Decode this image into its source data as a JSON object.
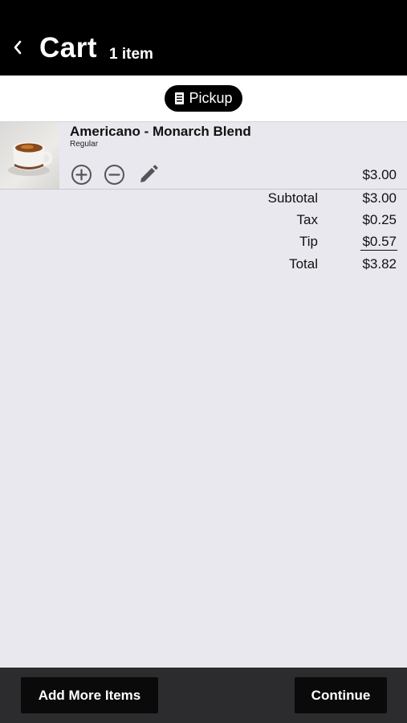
{
  "header": {
    "title": "Cart",
    "count": "1 item",
    "back_icon": "chevron-left-icon"
  },
  "order_mode": {
    "label": "Pickup",
    "icon": "receipt-icon"
  },
  "items": [
    {
      "name": "Americano - Monarch Blend",
      "variant": "Regular",
      "price": "$3.00",
      "controls": [
        "plus-circle-icon",
        "minus-circle-icon",
        "pencil-icon"
      ]
    }
  ],
  "summary": [
    {
      "label": "Subtotal",
      "value": "$3.00"
    },
    {
      "label": "Tax",
      "value": "$0.25"
    },
    {
      "label": "Tip",
      "value": "$0.57"
    },
    {
      "label": "Total",
      "value": "$3.82"
    }
  ],
  "footer": {
    "add_more_label": "Add More Items",
    "continue_label": "Continue"
  },
  "colors": {
    "header_bg": "#000000",
    "page_bg": "#e9e8ef",
    "footer_bg": "#2c2c2e",
    "button_bg": "#0a0a0a"
  }
}
